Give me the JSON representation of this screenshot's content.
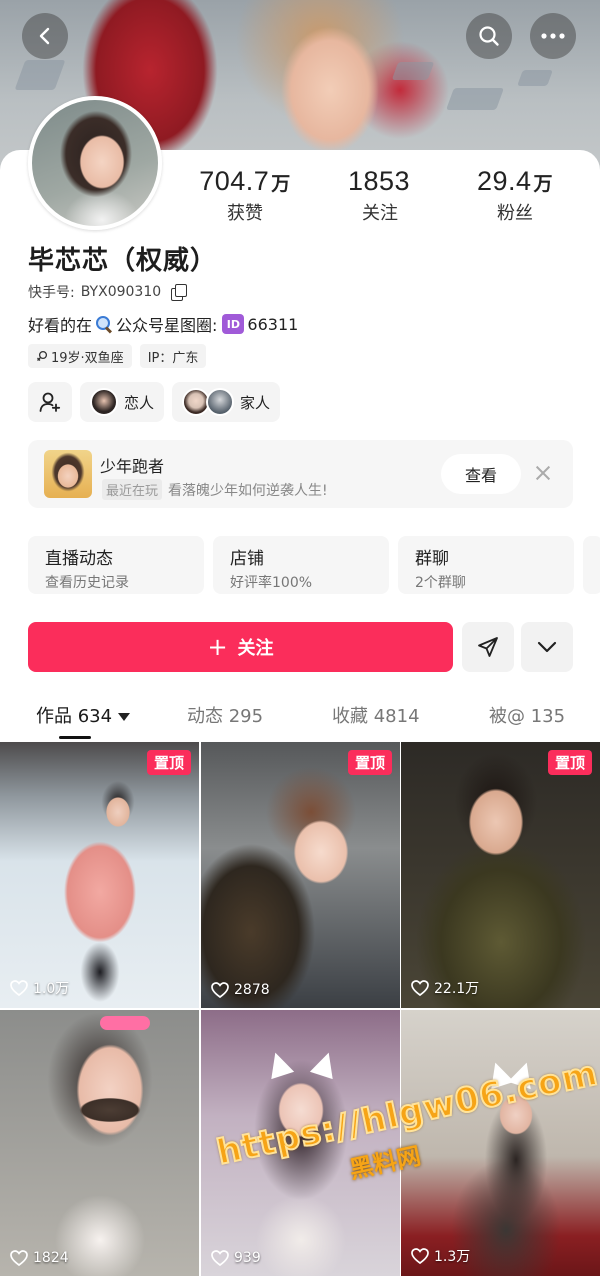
{
  "profile": {
    "name": "毕芯芯（权威）",
    "kuaishou_id_label": "快手号:",
    "kuaishou_id": "BYX090310",
    "bio_prefix": "好看的在",
    "bio_middle": "公众号星图圈:",
    "bio_id_icon": "ID",
    "bio_number": "66311",
    "tags": [
      {
        "label": "19岁·双鱼座"
      },
      {
        "label": "IP：广东"
      }
    ]
  },
  "stats": [
    {
      "value": "704.7",
      "unit": "万",
      "label": "获赞"
    },
    {
      "value": "1853",
      "unit": "",
      "label": "关注"
    },
    {
      "value": "29.4",
      "unit": "万",
      "label": "粉丝"
    }
  ],
  "relations": [
    {
      "label": "恋人"
    },
    {
      "label": "家人"
    }
  ],
  "game_card": {
    "title": "少年跑者",
    "chip": "最近在玩",
    "subtitle": "看落魄少年如何逆袭人生!",
    "button": "查看"
  },
  "services": [
    {
      "title": "直播动态",
      "subtitle": "查看历史记录"
    },
    {
      "title": "店铺",
      "subtitle": "好评率100%"
    },
    {
      "title": "群聊",
      "subtitle": "2个群聊"
    }
  ],
  "actions": {
    "follow_label": "关注",
    "follow_plus": "+"
  },
  "tabs": [
    {
      "label": "作品 634",
      "active": true
    },
    {
      "label": "动态 295",
      "active": false
    },
    {
      "label": "收藏 4814",
      "active": false
    },
    {
      "label": "被@ 135",
      "active": false
    }
  ],
  "posts": [
    {
      "pinned_label": "置顶",
      "likes": "1.0万"
    },
    {
      "pinned_label": "置顶",
      "likes": "2878"
    },
    {
      "pinned_label": "置顶",
      "likes": "22.1万"
    },
    {
      "pinned_label": "",
      "likes": "1824"
    },
    {
      "pinned_label": "",
      "likes": "939"
    },
    {
      "pinned_label": "",
      "likes": "1.3万"
    }
  ],
  "watermark": {
    "url": "https://hlgw06.com",
    "text": "黑料网"
  },
  "colors": {
    "accent": "#fb2d5b",
    "id_badge": "#a05ad8"
  },
  "icons": [
    "back-icon",
    "search-icon",
    "more-icon",
    "copy-icon",
    "magnifier-emoji-icon",
    "add-friend-icon",
    "close-icon",
    "plus-icon",
    "send-icon",
    "chevron-down-icon",
    "heart-icon",
    "caret-down-icon"
  ]
}
